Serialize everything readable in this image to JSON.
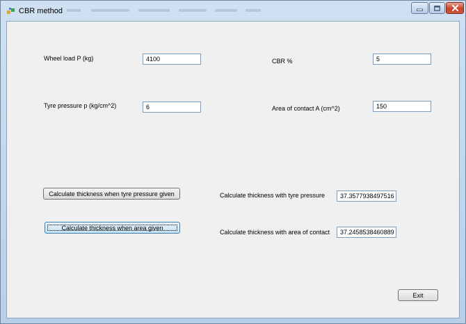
{
  "window": {
    "title": "CBR method"
  },
  "form": {
    "wheel_load": {
      "label": "Wheel load P (kg)",
      "value": "4100"
    },
    "cbr": {
      "label": "CBR %",
      "value": "5"
    },
    "tyre_pressure": {
      "label": "Tyre pressure p (kg/cm^2)",
      "value": "6"
    },
    "area_contact": {
      "label": "Area of contact A (cm^2)",
      "value": "150"
    }
  },
  "actions": {
    "calc_tyre_button": "Calculate thickness when tyre pressure given",
    "calc_area_button": "Calculate thickness when area given",
    "exit_button": "Exit"
  },
  "results": {
    "tyre": {
      "label": "Calculate thickness with tyre pressure",
      "value": "37.3577938497516"
    },
    "area": {
      "label": "Calculate thickness with area of contact",
      "value": "37.2458538460889"
    }
  },
  "icons": {
    "app": "app-icon",
    "minimize": "minimize-icon",
    "maximize": "maximize-icon",
    "close": "close-icon"
  },
  "colors": {
    "title_bar": "#cfe0f2",
    "client_bg": "#f0f0f0",
    "close_button": "#c7432a"
  }
}
